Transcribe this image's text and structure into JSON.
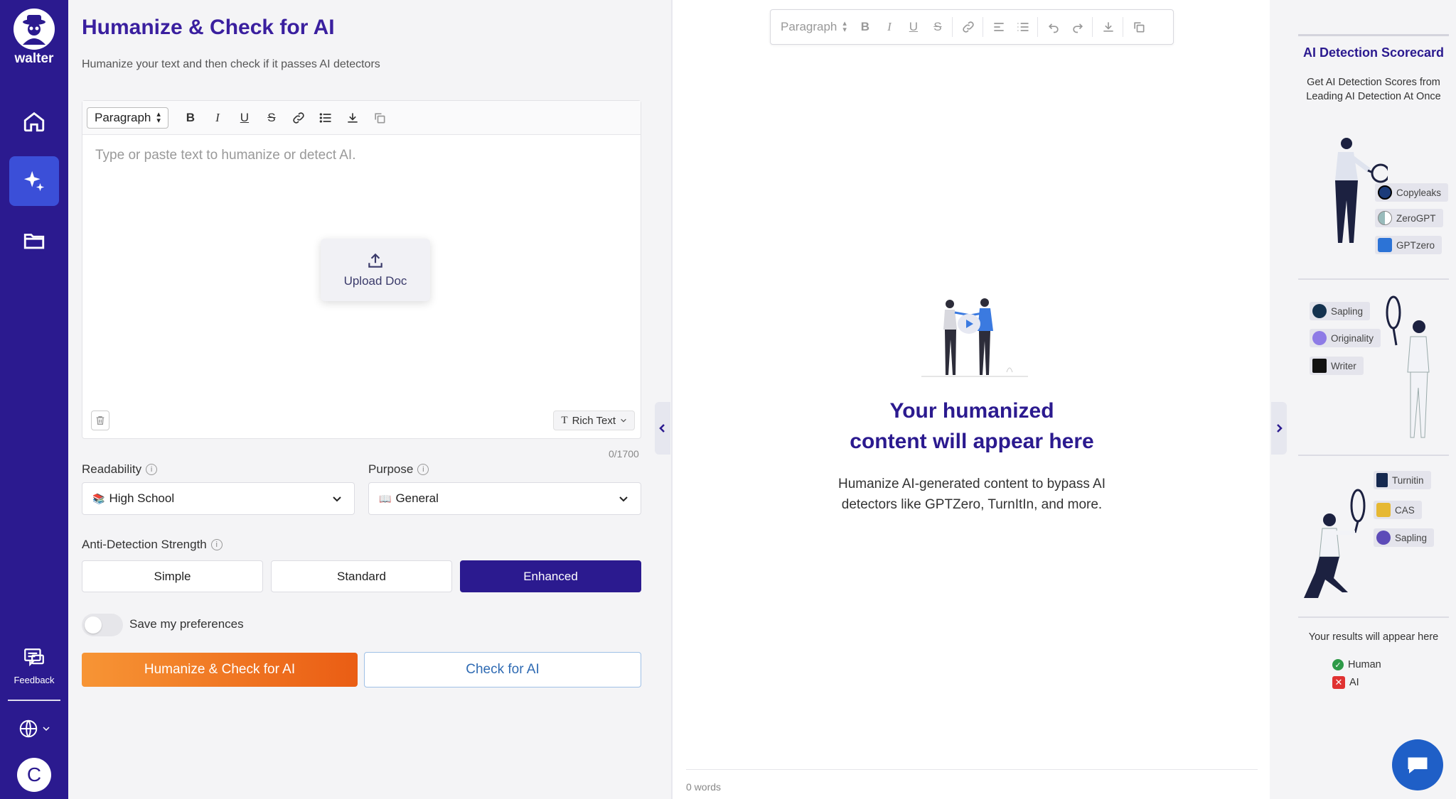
{
  "brand": {
    "name": "walter"
  },
  "sidebar": {
    "feedback_label": "Feedback",
    "avatar_initial": "C"
  },
  "header": {
    "title": "Humanize & Check for AI",
    "subtitle": "Humanize your text and then check if it passes AI detectors"
  },
  "editor": {
    "block_format": "Paragraph",
    "placeholder": "Type or paste text to humanize or detect AI.",
    "upload_label": "Upload Doc",
    "mode_label": "Rich Text",
    "counter": "0/1700"
  },
  "readability": {
    "label": "Readability",
    "value": "High School",
    "emoji": "📚"
  },
  "purpose": {
    "label": "Purpose",
    "value": "General",
    "emoji": "📖"
  },
  "strength": {
    "label": "Anti-Detection Strength",
    "options": [
      "Simple",
      "Standard",
      "Enhanced"
    ],
    "selected": "Enhanced"
  },
  "preferences": {
    "label": "Save my preferences",
    "enabled": false
  },
  "actions": {
    "primary": "Humanize & Check for AI",
    "secondary": "Check for AI"
  },
  "output": {
    "block_format": "Paragraph",
    "empty_title_line1": "Your humanized",
    "empty_title_line2": "content will appear here",
    "empty_desc_line1": "Humanize AI-generated content to bypass AI",
    "empty_desc_line2": "detectors like GPTZero, TurnItIn, and more.",
    "word_count": "0 words"
  },
  "scorecard": {
    "title": "AI Detection Scorecard",
    "subtitle_line1": "Get AI Detection Scores from",
    "subtitle_line2": "Leading AI Detection At Once",
    "detectors": [
      "Copyleaks",
      "ZeroGPT",
      "GPTzero",
      "Sapling",
      "Originality",
      "Writer",
      "Turnitin",
      "CAS",
      "Sapling"
    ],
    "results_label": "Your results will appear here",
    "legend_human": "Human",
    "legend_ai": "AI"
  },
  "colors": {
    "brand_purple": "#2b1a8f",
    "accent_orange": "#f07a25",
    "link_blue": "#2f6bb3"
  }
}
